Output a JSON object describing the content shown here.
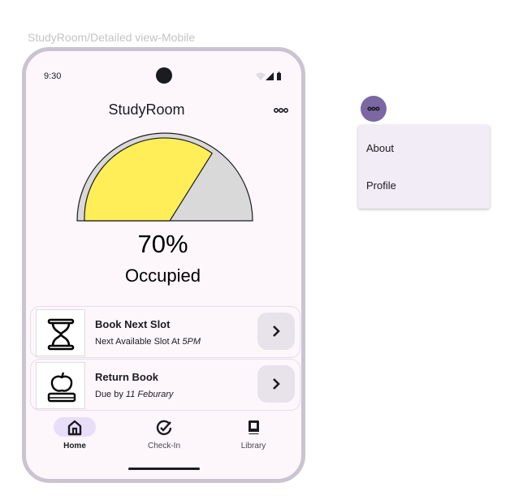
{
  "frame_label": "StudyRoom/Detailed view-Mobile",
  "status_bar": {
    "time": "9:30",
    "icons": [
      "wifi-icon",
      "signal-icon",
      "battery-icon"
    ]
  },
  "header": {
    "title": "StudyRoom",
    "menu_icon": "more-horizontal-icon"
  },
  "occupancy": {
    "level": 0.7,
    "percent_text": "70%",
    "label": "Occupied"
  },
  "cards": [
    {
      "title": "Book Next Slot",
      "sub_prefix": "Next Available Slot At ",
      "sub_value": "5PM",
      "icon": "hourglass-icon",
      "action_icon": "chevron-right-icon"
    },
    {
      "title": "Return Book",
      "sub_prefix": "Due by ",
      "sub_value": "11 Feburary",
      "icon": "apple-on-book-icon",
      "action_icon": "chevron-right-icon"
    }
  ],
  "nav": [
    {
      "label": "Home",
      "icon": "home-icon",
      "active": true
    },
    {
      "label": "Check-In",
      "icon": "check-circle-icon",
      "active": false
    },
    {
      "label": "Library",
      "icon": "book-icon",
      "active": false
    }
  ],
  "menu": {
    "items": [
      "About",
      "Profile"
    ]
  },
  "colors": {
    "gauge_fill": "#ffee58",
    "gauge_track": "#d9d9d9",
    "accent": "#7a67a3",
    "active_pill": "#e8def8",
    "background": "#fdf7fc"
  }
}
